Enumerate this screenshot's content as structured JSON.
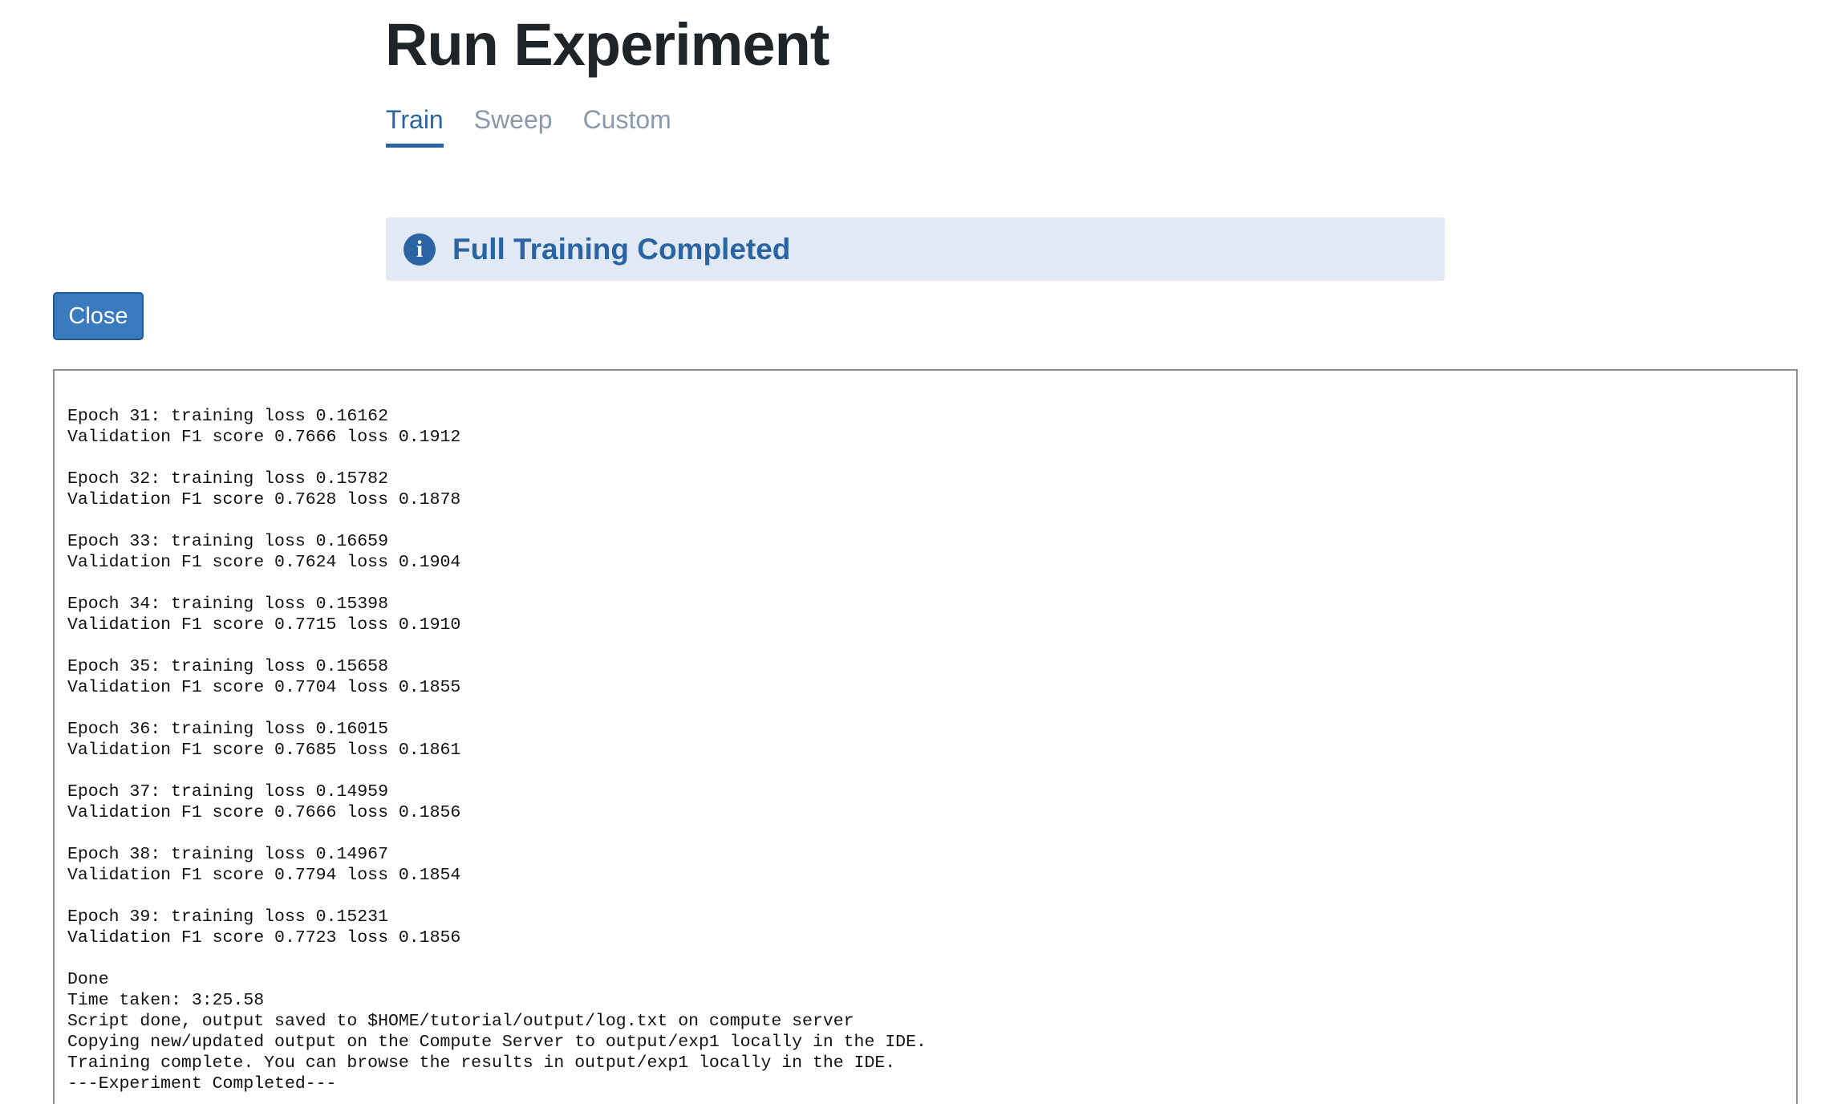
{
  "page": {
    "title": "Run Experiment"
  },
  "tabs": [
    {
      "label": "Train",
      "active": true
    },
    {
      "label": "Sweep",
      "active": false
    },
    {
      "label": "Custom",
      "active": false
    }
  ],
  "alert": {
    "icon": "info-icon",
    "text": "Full Training Completed",
    "color": "#2b64a3",
    "background": "#e1eaf4"
  },
  "close_button": {
    "label": "Close"
  },
  "log": {
    "lines": [
      "Epoch 31: training loss 0.16162",
      "Validation F1 score 0.7666 loss 0.1912",
      "",
      "Epoch 32: training loss 0.15782",
      "Validation F1 score 0.7628 loss 0.1878",
      "",
      "Epoch 33: training loss 0.16659",
      "Validation F1 score 0.7624 loss 0.1904",
      "",
      "Epoch 34: training loss 0.15398",
      "Validation F1 score 0.7715 loss 0.1910",
      "",
      "Epoch 35: training loss 0.15658",
      "Validation F1 score 0.7704 loss 0.1855",
      "",
      "Epoch 36: training loss 0.16015",
      "Validation F1 score 0.7685 loss 0.1861",
      "",
      "Epoch 37: training loss 0.14959",
      "Validation F1 score 0.7666 loss 0.1856",
      "",
      "Epoch 38: training loss 0.14967",
      "Validation F1 score 0.7794 loss 0.1854",
      "",
      "Epoch 39: training loss 0.15231",
      "Validation F1 score 0.7723 loss 0.1856",
      "",
      "Done",
      "Time taken: 3:25.58",
      "Script done, output saved to $HOME/tutorial/output/log.txt on compute server",
      "Copying new/updated output on the Compute Server to output/exp1 locally in the IDE.",
      "Training complete. You can browse the results in output/exp1 locally in the IDE.",
      "---Experiment Completed---"
    ]
  }
}
